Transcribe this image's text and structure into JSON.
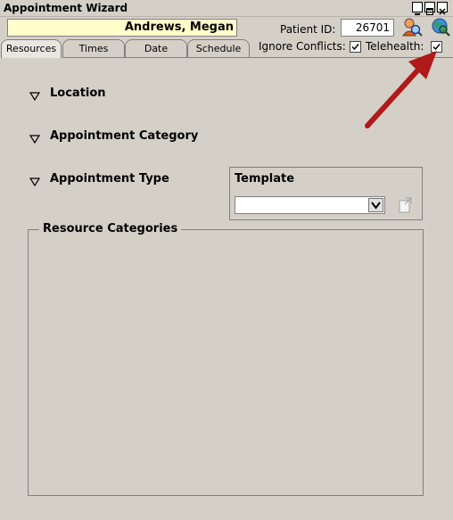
{
  "window": {
    "title": "Appointment Wizard"
  },
  "header": {
    "patient_name": "Andrews, Megan",
    "patient_id_label": "Patient ID:",
    "patient_id_value": "26701",
    "ignore_conflicts_label": "Ignore Conflicts:",
    "ignore_conflicts_checked": true,
    "telehealth_label": "Telehealth:",
    "telehealth_checked": true
  },
  "tabs": [
    {
      "label": "Resources",
      "active": true
    },
    {
      "label": "Times"
    },
    {
      "label": "Date"
    },
    {
      "label": "Schedule"
    }
  ],
  "sections": {
    "location": "Location",
    "appointment_category": "Appointment Category",
    "appointment_type": "Appointment Type"
  },
  "template": {
    "title": "Template",
    "selected": ""
  },
  "resource_categories": {
    "title": "Resource Categories"
  },
  "colors": {
    "accent_arrow": "#b01a1a",
    "name_field_bg": "#ffffcc",
    "window_bg": "#d4d0c8"
  }
}
